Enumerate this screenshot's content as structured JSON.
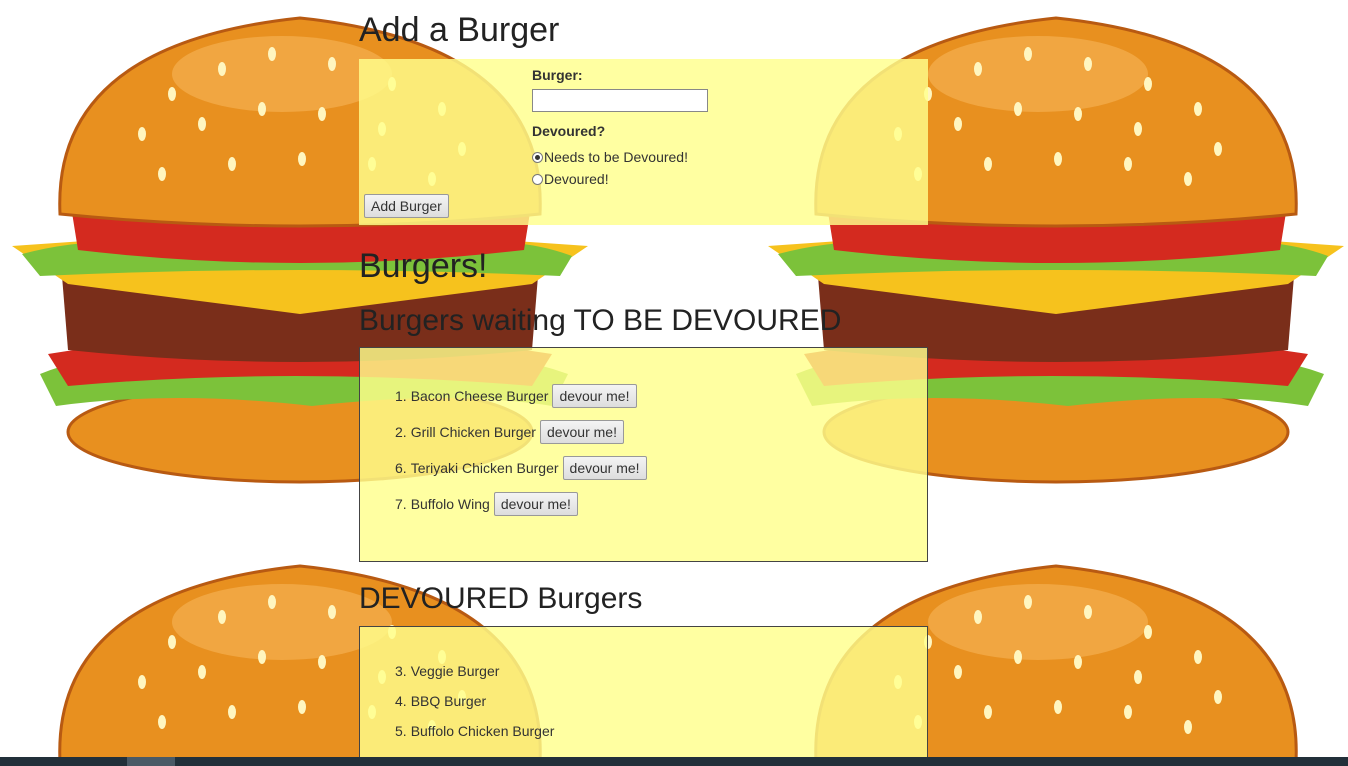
{
  "form": {
    "heading": "Add a Burger",
    "burger_label": "Burger:",
    "burger_value": "",
    "devoured_label": "Devoured?",
    "options": [
      {
        "label": "Needs to be Devoured!",
        "checked": true
      },
      {
        "label": "Devoured!",
        "checked": false
      }
    ],
    "submit_label": "Add Burger"
  },
  "main_heading": "Burgers!",
  "waiting": {
    "heading": "Burgers waiting TO BE DEVOURED",
    "button_label": "devour me!",
    "items": [
      {
        "num": "1.",
        "name": "Bacon Cheese Burger"
      },
      {
        "num": "2.",
        "name": "Grill Chicken Burger"
      },
      {
        "num": "6.",
        "name": "Teriyaki Chicken Burger"
      },
      {
        "num": "7.",
        "name": "Buffolo Wing"
      }
    ]
  },
  "devoured": {
    "heading": "DEVOURED Burgers",
    "items": [
      {
        "num": "3.",
        "name": "Veggie Burger"
      },
      {
        "num": "4.",
        "name": "BBQ Burger"
      },
      {
        "num": "5.",
        "name": "Buffolo Chicken Burger"
      }
    ]
  },
  "background": {
    "icon": "burger-illustration",
    "colors": {
      "bun": "#e8901f",
      "bun_dark": "#c25e10",
      "cheese": "#f6c21d",
      "lettuce": "#7cc23a",
      "tomato": "#d42a1f",
      "patty": "#7a2e1a",
      "seed": "#fff6c0"
    }
  },
  "colors": {
    "panel": "#ffff8c"
  }
}
